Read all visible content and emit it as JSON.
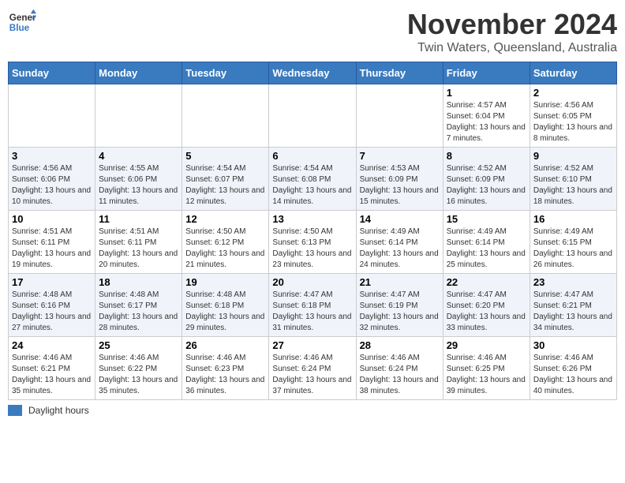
{
  "header": {
    "logo_text_general": "General",
    "logo_text_blue": "Blue",
    "main_title": "November 2024",
    "subtitle": "Twin Waters, Queensland, Australia"
  },
  "calendar": {
    "days_of_week": [
      "Sunday",
      "Monday",
      "Tuesday",
      "Wednesday",
      "Thursday",
      "Friday",
      "Saturday"
    ],
    "weeks": [
      [
        {
          "day": "",
          "info": ""
        },
        {
          "day": "",
          "info": ""
        },
        {
          "day": "",
          "info": ""
        },
        {
          "day": "",
          "info": ""
        },
        {
          "day": "",
          "info": ""
        },
        {
          "day": "1",
          "info": "Sunrise: 4:57 AM\nSunset: 6:04 PM\nDaylight: 13 hours and 7 minutes."
        },
        {
          "day": "2",
          "info": "Sunrise: 4:56 AM\nSunset: 6:05 PM\nDaylight: 13 hours and 8 minutes."
        }
      ],
      [
        {
          "day": "3",
          "info": "Sunrise: 4:56 AM\nSunset: 6:06 PM\nDaylight: 13 hours and 10 minutes."
        },
        {
          "day": "4",
          "info": "Sunrise: 4:55 AM\nSunset: 6:06 PM\nDaylight: 13 hours and 11 minutes."
        },
        {
          "day": "5",
          "info": "Sunrise: 4:54 AM\nSunset: 6:07 PM\nDaylight: 13 hours and 12 minutes."
        },
        {
          "day": "6",
          "info": "Sunrise: 4:54 AM\nSunset: 6:08 PM\nDaylight: 13 hours and 14 minutes."
        },
        {
          "day": "7",
          "info": "Sunrise: 4:53 AM\nSunset: 6:09 PM\nDaylight: 13 hours and 15 minutes."
        },
        {
          "day": "8",
          "info": "Sunrise: 4:52 AM\nSunset: 6:09 PM\nDaylight: 13 hours and 16 minutes."
        },
        {
          "day": "9",
          "info": "Sunrise: 4:52 AM\nSunset: 6:10 PM\nDaylight: 13 hours and 18 minutes."
        }
      ],
      [
        {
          "day": "10",
          "info": "Sunrise: 4:51 AM\nSunset: 6:11 PM\nDaylight: 13 hours and 19 minutes."
        },
        {
          "day": "11",
          "info": "Sunrise: 4:51 AM\nSunset: 6:11 PM\nDaylight: 13 hours and 20 minutes."
        },
        {
          "day": "12",
          "info": "Sunrise: 4:50 AM\nSunset: 6:12 PM\nDaylight: 13 hours and 21 minutes."
        },
        {
          "day": "13",
          "info": "Sunrise: 4:50 AM\nSunset: 6:13 PM\nDaylight: 13 hours and 23 minutes."
        },
        {
          "day": "14",
          "info": "Sunrise: 4:49 AM\nSunset: 6:14 PM\nDaylight: 13 hours and 24 minutes."
        },
        {
          "day": "15",
          "info": "Sunrise: 4:49 AM\nSunset: 6:14 PM\nDaylight: 13 hours and 25 minutes."
        },
        {
          "day": "16",
          "info": "Sunrise: 4:49 AM\nSunset: 6:15 PM\nDaylight: 13 hours and 26 minutes."
        }
      ],
      [
        {
          "day": "17",
          "info": "Sunrise: 4:48 AM\nSunset: 6:16 PM\nDaylight: 13 hours and 27 minutes."
        },
        {
          "day": "18",
          "info": "Sunrise: 4:48 AM\nSunset: 6:17 PM\nDaylight: 13 hours and 28 minutes."
        },
        {
          "day": "19",
          "info": "Sunrise: 4:48 AM\nSunset: 6:18 PM\nDaylight: 13 hours and 29 minutes."
        },
        {
          "day": "20",
          "info": "Sunrise: 4:47 AM\nSunset: 6:18 PM\nDaylight: 13 hours and 31 minutes."
        },
        {
          "day": "21",
          "info": "Sunrise: 4:47 AM\nSunset: 6:19 PM\nDaylight: 13 hours and 32 minutes."
        },
        {
          "day": "22",
          "info": "Sunrise: 4:47 AM\nSunset: 6:20 PM\nDaylight: 13 hours and 33 minutes."
        },
        {
          "day": "23",
          "info": "Sunrise: 4:47 AM\nSunset: 6:21 PM\nDaylight: 13 hours and 34 minutes."
        }
      ],
      [
        {
          "day": "24",
          "info": "Sunrise: 4:46 AM\nSunset: 6:21 PM\nDaylight: 13 hours and 35 minutes."
        },
        {
          "day": "25",
          "info": "Sunrise: 4:46 AM\nSunset: 6:22 PM\nDaylight: 13 hours and 35 minutes."
        },
        {
          "day": "26",
          "info": "Sunrise: 4:46 AM\nSunset: 6:23 PM\nDaylight: 13 hours and 36 minutes."
        },
        {
          "day": "27",
          "info": "Sunrise: 4:46 AM\nSunset: 6:24 PM\nDaylight: 13 hours and 37 minutes."
        },
        {
          "day": "28",
          "info": "Sunrise: 4:46 AM\nSunset: 6:24 PM\nDaylight: 13 hours and 38 minutes."
        },
        {
          "day": "29",
          "info": "Sunrise: 4:46 AM\nSunset: 6:25 PM\nDaylight: 13 hours and 39 minutes."
        },
        {
          "day": "30",
          "info": "Sunrise: 4:46 AM\nSunset: 6:26 PM\nDaylight: 13 hours and 40 minutes."
        }
      ]
    ]
  },
  "legend": {
    "label": "Daylight hours"
  }
}
